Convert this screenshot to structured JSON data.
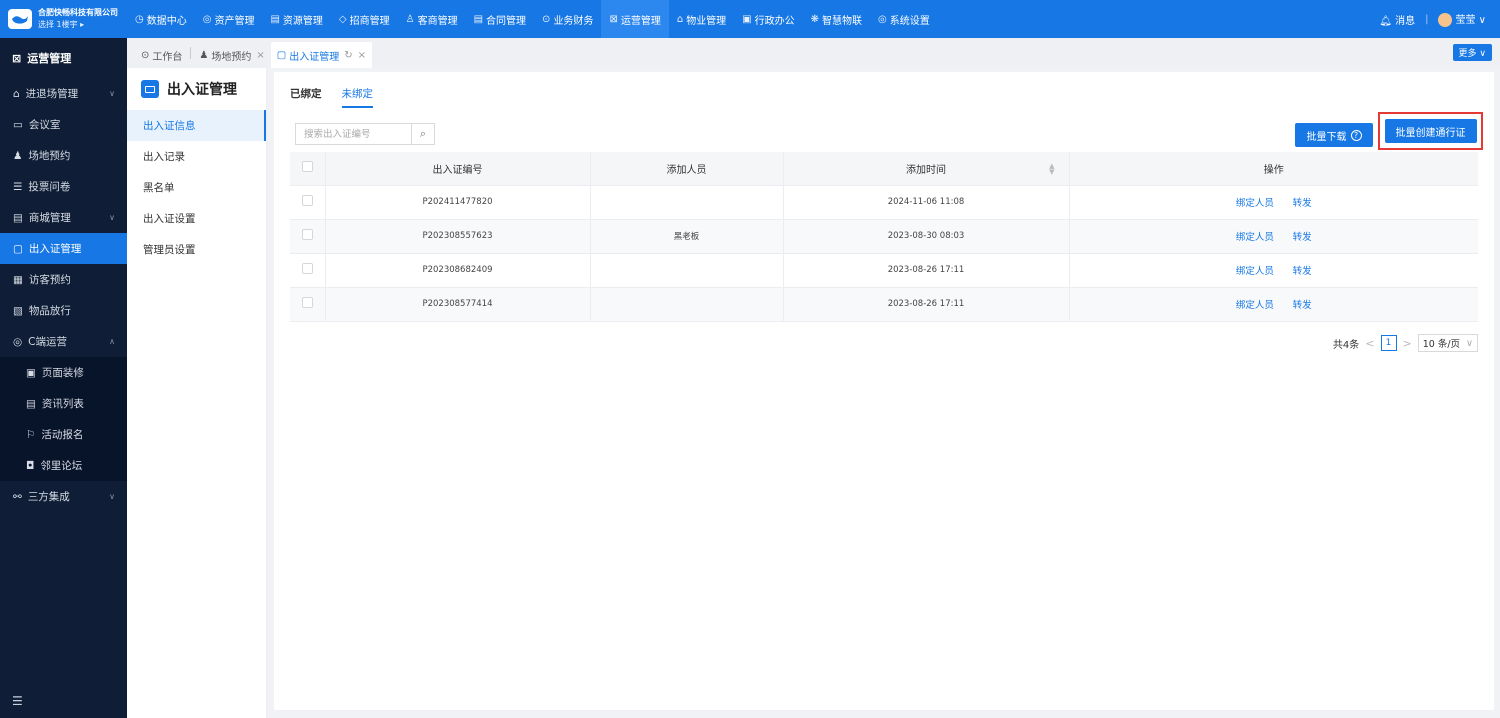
{
  "header": {
    "company": "合肥快畅科技有限公司",
    "building": "选择 1楼宇 ▸",
    "nav": [
      {
        "icon": "◷",
        "label": "数据中心"
      },
      {
        "icon": "◎",
        "label": "资产管理"
      },
      {
        "icon": "▤",
        "label": "资源管理"
      },
      {
        "icon": "◇",
        "label": "招商管理"
      },
      {
        "icon": "♙",
        "label": "客商管理"
      },
      {
        "icon": "▤",
        "label": "合同管理"
      },
      {
        "icon": "⊙",
        "label": "业务财务"
      },
      {
        "icon": "⊠",
        "label": "运营管理"
      },
      {
        "icon": "⌂",
        "label": "物业管理"
      },
      {
        "icon": "▣",
        "label": "行政办公"
      },
      {
        "icon": "❋",
        "label": "智慧物联"
      },
      {
        "icon": "◎",
        "label": "系统设置"
      }
    ],
    "message_label": "消息",
    "user_name": "莹莹"
  },
  "sidebar": {
    "title": "运营管理",
    "items": [
      {
        "icon": "⌂",
        "label": "进退场管理"
      },
      {
        "icon": "▭",
        "label": "会议室"
      },
      {
        "icon": "♟",
        "label": "场地预约"
      },
      {
        "icon": "☰",
        "label": "投票问卷"
      },
      {
        "icon": "▤",
        "label": "商城管理"
      },
      {
        "icon": "▢",
        "label": "出入证管理"
      },
      {
        "icon": "▦",
        "label": "访客预约"
      },
      {
        "icon": "▧",
        "label": "物品放行"
      },
      {
        "icon": "◎",
        "label": "C端运营"
      }
    ],
    "sub_items": [
      {
        "icon": "▣",
        "label": "页面装修"
      },
      {
        "icon": "▤",
        "label": "资讯列表"
      },
      {
        "icon": "⚐",
        "label": "活动报名"
      },
      {
        "icon": "◘",
        "label": "邻里论坛"
      }
    ],
    "extra": {
      "icon": "⚯",
      "label": "三方集成"
    },
    "footer_icon": "☰"
  },
  "tabs": {
    "items": [
      {
        "icon": "⊙",
        "label": "工作台"
      },
      {
        "icon": "♟",
        "label": "场地预约"
      },
      {
        "icon": "▢",
        "label": "出入证管理"
      }
    ],
    "more": "更多 ∨"
  },
  "left_panel": {
    "title": "出入证管理",
    "items": [
      "出入证信息",
      "出入记录",
      "黑名单",
      "出入证设置",
      "管理员设置"
    ]
  },
  "main": {
    "subtabs": [
      "已绑定",
      "未绑定"
    ],
    "search_placeholder": "搜索出入证编号",
    "download_label": "批量下载",
    "create_label": "批量创建通行证",
    "columns": [
      "出入证编号",
      "添加人员",
      "添加时间",
      "操作"
    ],
    "rows": [
      {
        "code": "P202411477820",
        "person": "",
        "time": "2024-11-06 11:08"
      },
      {
        "code": "P202308557623",
        "person": "黑老板",
        "time": "2023-08-30 08:03"
      },
      {
        "code": "P202308682409",
        "person": "",
        "time": "2023-08-26 17:11"
      },
      {
        "code": "P202308577414",
        "person": "",
        "time": "2023-08-26 17:11"
      }
    ],
    "actions": [
      "绑定人员",
      "转发"
    ],
    "pager": {
      "total": "共4条",
      "page": "1",
      "size": "10 条/页"
    }
  }
}
